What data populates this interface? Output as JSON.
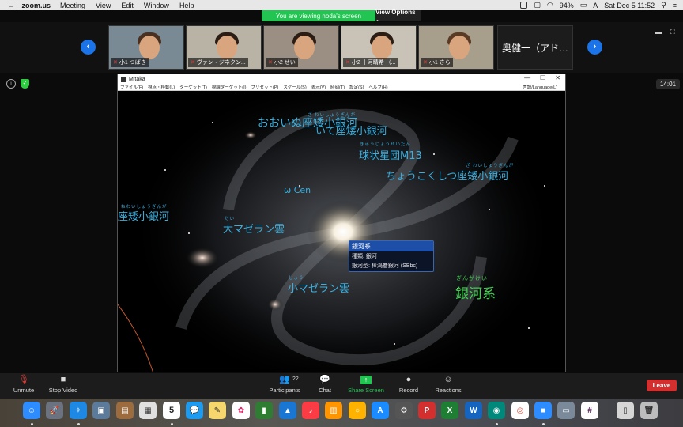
{
  "menubar": {
    "apple": "",
    "app": "zoom.us",
    "items": [
      "Meeting",
      "View",
      "Edit",
      "Window",
      "Help"
    ],
    "battery": "94%",
    "datetime": "Sat Dec 5  11:52"
  },
  "share_banner": {
    "text": "You are viewing noda's screen",
    "view_options": "View Options ⌄"
  },
  "gallery": {
    "prev": "‹",
    "next": "›",
    "participants": [
      {
        "name": "小1 つばき",
        "bg": "#7a8a95"
      },
      {
        "name": "ヴァン・ジネクン...",
        "bg": "#b9b3a6"
      },
      {
        "name": "小2 せい",
        "bg": "#9a8f82"
      },
      {
        "name": "小2 十河晴希 （...",
        "bg": "#c9c2b6"
      },
      {
        "name": "小1 さら",
        "bg": "#a89e8c"
      }
    ],
    "text_tile": "奥健一（アド…"
  },
  "stage": {
    "timer": "14:01"
  },
  "mitaka": {
    "title": "Mitaka",
    "menus": [
      "ファイル(F)",
      "視点・移動(L)",
      "ターゲット(T)",
      "視線ターゲット(I)",
      "プリセット(P)",
      "スケール(S)",
      "表示(V)",
      "時刻(T)",
      "設定(S)",
      "ヘルプ(H)"
    ],
    "language": "言語/Language(L)",
    "labels": {
      "canis_major": "おおいぬ座矮小銀河",
      "sag_dwarf": "いて座矮小銀河",
      "m13": "球状星団M13",
      "m13_furi": "きゅうじょうせいだん",
      "ursa_minor": "ちょうこくしつ座矮小銀河",
      "ursa_minor_furi": "ざ わいしょうぎんが",
      "omega_cen": "ω Cen",
      "left_edge": "座矮小銀河",
      "left_edge_furi": "ねわいしょうぎんが",
      "lmc": "大マゼラン雲",
      "lmc_furi": "だい",
      "smc": "小マゼラン雲",
      "smc_furi": "しょう",
      "milky_way": "銀河系",
      "milky_way_furi": "ぎんがけい",
      "top_furi": "ざ わいしょうぎんが"
    },
    "tooltip": {
      "title": "銀河系",
      "line1": "種類: 銀河",
      "line2": "銀河型: 棒渦巻銀河 (SBbc)"
    }
  },
  "toolbar": {
    "unmute": "Unmute",
    "stop_video": "Stop Video",
    "participants": "Participants",
    "participants_count": "22",
    "chat": "Chat",
    "share_screen": "Share Screen",
    "record": "Record",
    "reactions": "Reactions",
    "leave": "Leave"
  },
  "dock": {
    "calendar_day": "5",
    "calendar_month": "DEC",
    "calendar_badge": "222",
    "appstore_badge": "2"
  }
}
